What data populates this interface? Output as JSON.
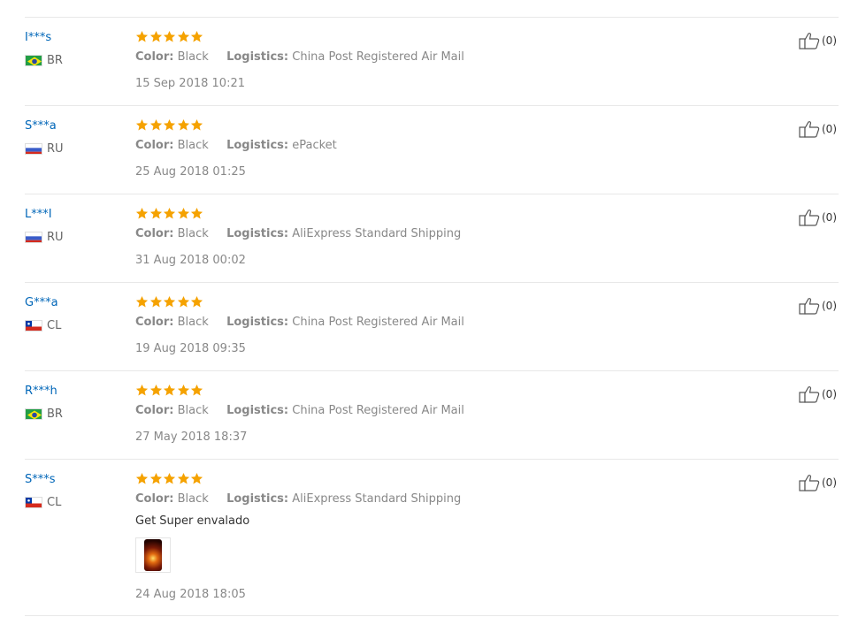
{
  "icons": {
    "star": "star-icon",
    "thumb": "thumbs-up-icon"
  },
  "colors": {
    "username": "#0066b8",
    "star": "#f5a200"
  },
  "labels": {
    "color": "Color:",
    "logistics": "Logistics:"
  },
  "reviews": [
    {
      "user": "I***s",
      "country": "BR",
      "flag": "brazil",
      "rating": 5,
      "color": "Black",
      "logistics": "China Post Registered Air Mail",
      "date": "15 Sep 2018 10:21",
      "helpful": "(0)"
    },
    {
      "user": "S***a",
      "country": "RU",
      "flag": "russia",
      "rating": 5,
      "color": "Black",
      "logistics": "ePacket",
      "date": "25 Aug 2018 01:25",
      "helpful": "(0)"
    },
    {
      "user": "L***I",
      "country": "RU",
      "flag": "russia",
      "rating": 5,
      "color": "Black",
      "logistics": "AliExpress Standard Shipping",
      "date": "31 Aug 2018 00:02",
      "helpful": "(0)"
    },
    {
      "user": "G***a",
      "country": "CL",
      "flag": "chile",
      "rating": 5,
      "color": "Black",
      "logistics": "China Post Registered Air Mail",
      "date": "19 Aug 2018 09:35",
      "helpful": "(0)"
    },
    {
      "user": "R***h",
      "country": "BR",
      "flag": "brazil",
      "rating": 5,
      "color": "Black",
      "logistics": "China Post Registered Air Mail",
      "date": "27 May 2018 18:37",
      "helpful": "(0)"
    },
    {
      "user": "S***s",
      "country": "CL",
      "flag": "chile",
      "rating": 5,
      "color": "Black",
      "logistics": "AliExpress Standard Shipping",
      "comment": "Get Super envalado",
      "has_photo": true,
      "date": "24 Aug 2018 18:05",
      "helpful": "(0)"
    }
  ]
}
